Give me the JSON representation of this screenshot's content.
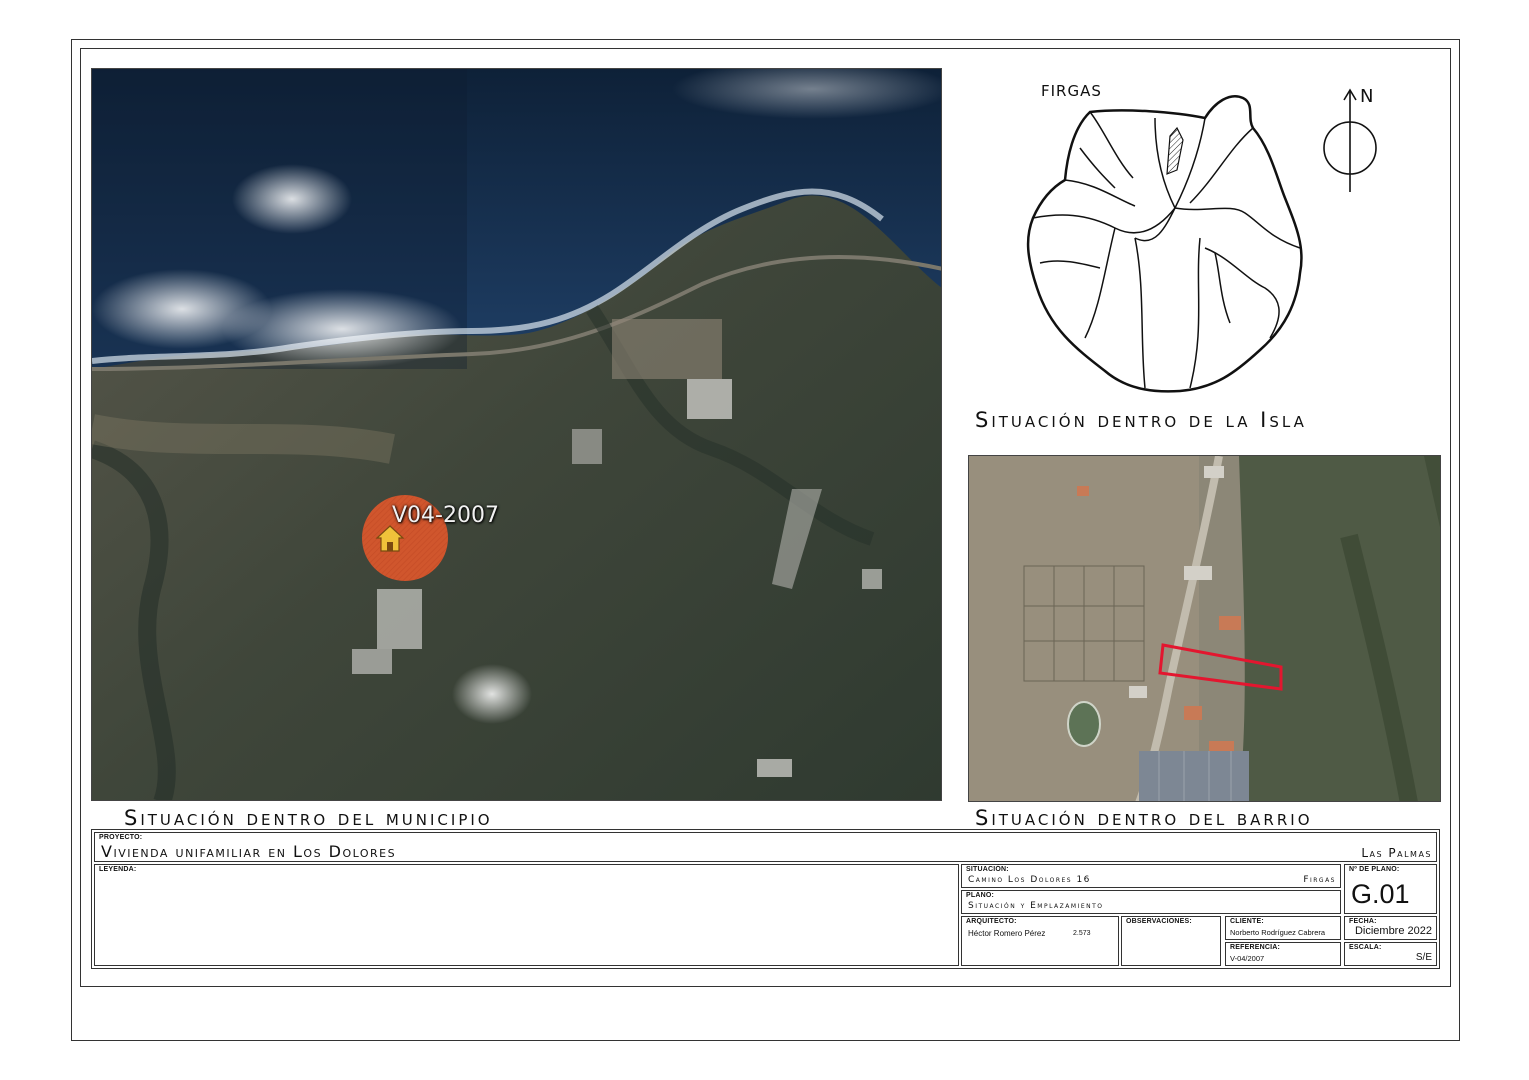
{
  "captions": {
    "municipio": "Situación dentro del municipio",
    "isla": "Situación dentro de la Isla",
    "barrio": "Situación dentro del barrio"
  },
  "municipio_map": {
    "marker_label": "V04-2007",
    "marker_color": "#e0582c",
    "marker_icon": "house-icon"
  },
  "isla_map": {
    "municipality_label": "FIRGAS",
    "north_label": "N",
    "north_icon": "north-arrow-icon"
  },
  "barrio_map": {
    "parcel_outline_color": "#e3162f"
  },
  "title_block": {
    "proyecto_label": "PROYECTO:",
    "proyecto_value": "Vivienda unifamiliar en Los Dolores",
    "location_city": "Las Palmas",
    "leyenda_label": "LEYENDA:",
    "situacion_label": "SITUACIÓN:",
    "situacion_value": "Camino Los Dolores 16",
    "situacion_municipio": "Firgas",
    "plano_label": "PLANO:",
    "plano_value": "Situación y Emplazamiento",
    "num_plano_label": "Nº DE PLANO:",
    "num_plano_value": "G.01",
    "arquitecto_label": "ARQUITECTO:",
    "arquitecto_value": "Héctor Romero Pérez",
    "arquitecto_colegiado": "2.573",
    "observaciones_label": "OBSERVACIONES:",
    "cliente_label": "CLIENTE:",
    "cliente_value": "Norberto Rodríguez Cabrera",
    "referencia_label": "REFERENCIA:",
    "referencia_value": "V-04/2007",
    "fecha_label": "FECHA:",
    "fecha_value": "Diciembre 2022",
    "escala_label": "ESCALA:",
    "escala_value": "S/E"
  }
}
